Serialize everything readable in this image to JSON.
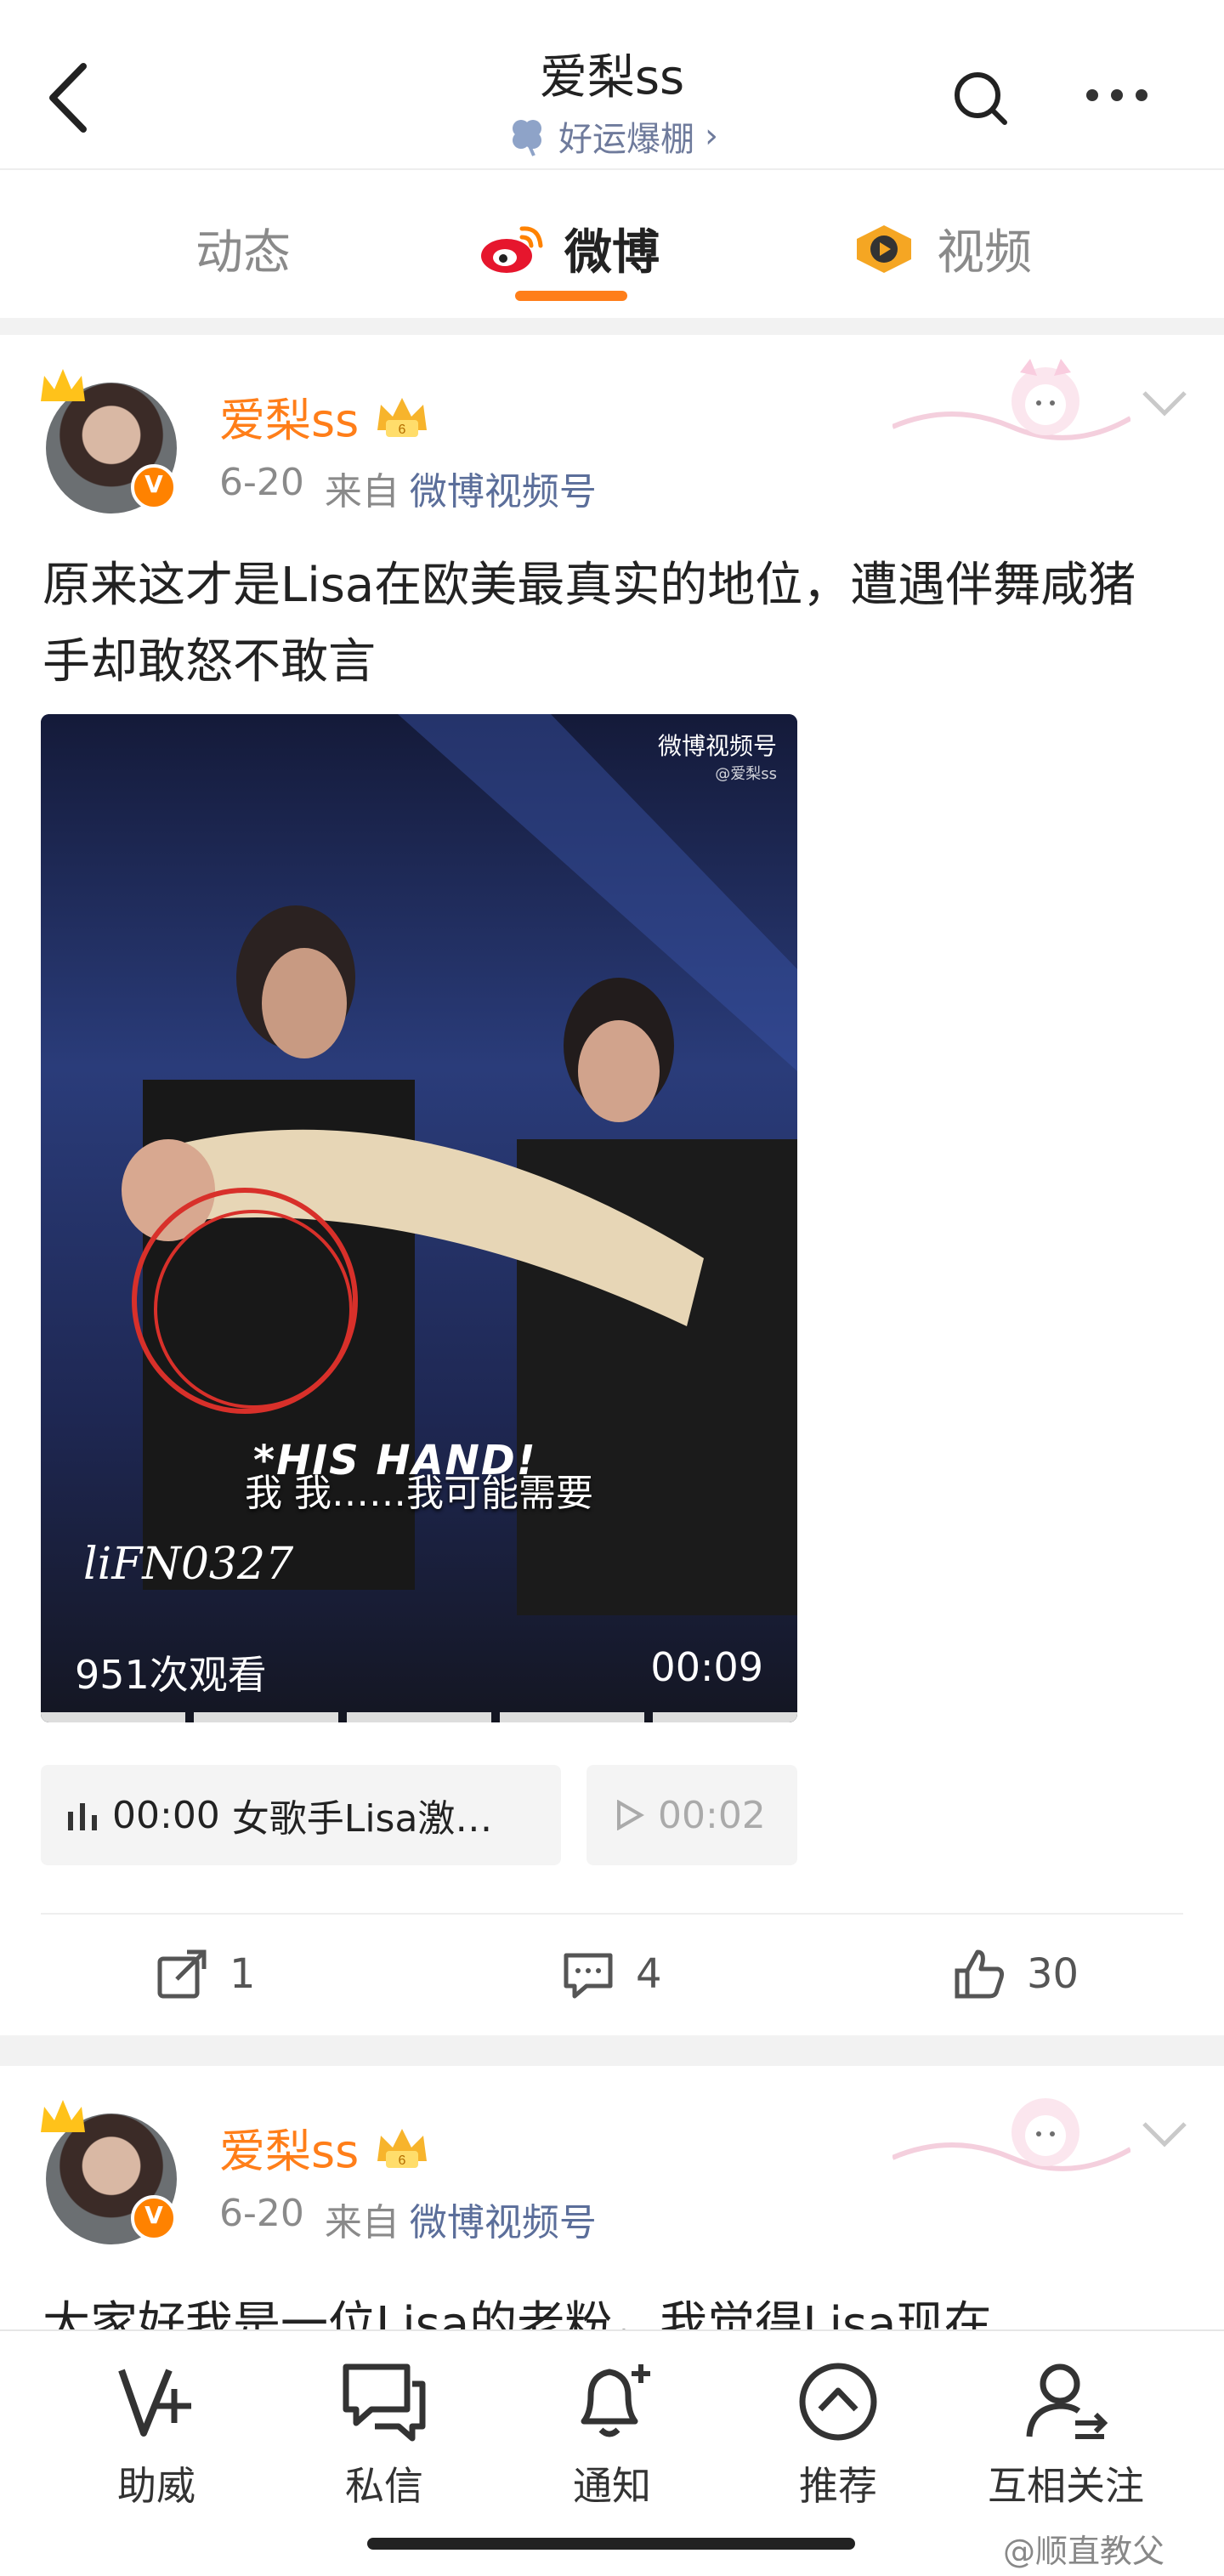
{
  "header": {
    "title": "爱梨ss",
    "subtitle": "好运爆棚",
    "subtitle_chevron": "›"
  },
  "tabs": [
    {
      "label": "动态",
      "active": false
    },
    {
      "label": "微博",
      "active": true
    },
    {
      "label": "视频",
      "active": false
    }
  ],
  "posts": [
    {
      "author": "爱梨ss",
      "date": "6-20",
      "from_label": "来自",
      "source": "微博视频号",
      "text": "原来这才是Lisa在欧美最真实的地位，遭遇伴舞咸猪手却敢怒不敢言",
      "video": {
        "logo": "微博视频号",
        "logo_sub": "@爱梨ss",
        "overlay_caption": "*HIS HAND!",
        "subtitle": "我 我……我可能需要",
        "signature": "liFN0327",
        "views": "951次观看",
        "duration": "00:09"
      },
      "audio_chip": {
        "time": "00:00",
        "title": "女歌手Lisa激…"
      },
      "audio_chip2": {
        "time": "00:02"
      },
      "actions": {
        "repost": "1",
        "comment": "4",
        "like": "30"
      }
    },
    {
      "author": "爱梨ss",
      "date": "6-20",
      "from_label": "来自",
      "source": "微博视频号",
      "text": "大家好我是一位Lisa的老粉，我觉得Lisa现在"
    }
  ],
  "bottom_nav": [
    {
      "label": "助威",
      "icon": "v-plus-icon"
    },
    {
      "label": "私信",
      "icon": "message-icon"
    },
    {
      "label": "通知",
      "icon": "bell-icon"
    },
    {
      "label": "推荐",
      "icon": "up-circle-icon"
    },
    {
      "label": "互相关注",
      "icon": "mutual-follow-icon"
    }
  ],
  "watermark": "@顺直教父",
  "colors": {
    "accent": "#ff7e19",
    "source_blue": "#5b6e9a",
    "muted": "#8a8a8a",
    "band": "#f2f2f2"
  }
}
